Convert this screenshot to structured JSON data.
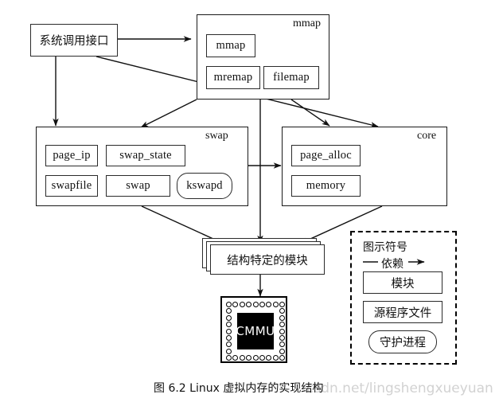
{
  "figure": {
    "caption": "图 6.2   Linux 虚拟内存的实现结构",
    "watermark": "csdn.net/lingshengxueyuan"
  },
  "nodes": {
    "syscall": {
      "label": "系统调用接口"
    },
    "arch_specific": {
      "label": "结构特定的模块"
    },
    "chip": {
      "label": "CMMU"
    }
  },
  "groups": {
    "mmap": {
      "title": "mmap",
      "items": [
        {
          "label": "mmap"
        },
        {
          "label": "mremap"
        },
        {
          "label": "filemap"
        }
      ]
    },
    "swap": {
      "title": "swap",
      "items": [
        {
          "label": "page_ip"
        },
        {
          "label": "swap_state"
        },
        {
          "label": "swapfile"
        },
        {
          "label": "swap"
        },
        {
          "label": "kswapd"
        }
      ]
    },
    "core": {
      "title": "core",
      "items": [
        {
          "label": "page_alloc"
        },
        {
          "label": "memory"
        }
      ]
    }
  },
  "legend": {
    "title": "图示符号",
    "dependency_label": "依赖",
    "module_label": "模块",
    "source_file_label": "源程序文件",
    "daemon_label": "守护进程"
  },
  "colors": {
    "stroke": "#1a1a1a",
    "background": "#ffffff",
    "chip_fill": "#000000",
    "chip_text": "#ffffff",
    "watermark": "#d2d2d2"
  }
}
